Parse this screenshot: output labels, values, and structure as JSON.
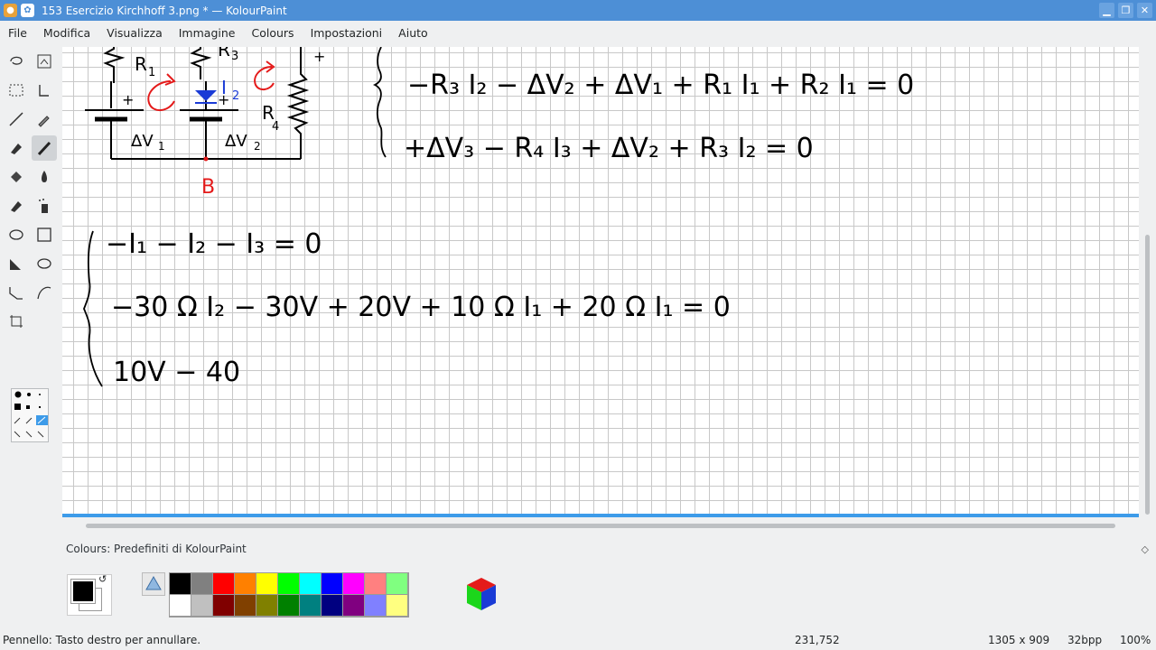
{
  "window": {
    "title": "153 Esercizio Kirchhoff 3.png * — KolourPaint",
    "controls": [
      "minimize",
      "maximize",
      "close"
    ]
  },
  "menu": [
    "File",
    "Modifica",
    "Visualizza",
    "Immagine",
    "Colours",
    "Impostazioni",
    "Aiuto"
  ],
  "tools": [
    "free-select-icon",
    "crop-icon",
    "rect-select-icon",
    "text-icon",
    "line-icon",
    "picker-icon",
    "eraser-icon",
    "brush-icon",
    "fill-icon",
    "blur-icon",
    "color-eraser-icon",
    "spraycan-icon",
    "ellipse-icon",
    "rectangle-icon",
    "polygon-icon",
    "ellipse2-icon",
    "polyline-icon",
    "curve-icon",
    "resize-icon"
  ],
  "drawing": {
    "label_R1": "R",
    "label_R1_sub": "1",
    "label_R3": "R",
    "label_R3_sub": "3",
    "label_R4": "R",
    "label_R4_sub": "4",
    "label_I2": "I",
    "label_I2_sub": "2",
    "label_dV1": "ΔV",
    "label_dV1_sub": "1",
    "label_dV2": "ΔV",
    "label_dV2_sub": "2",
    "label_B": "B",
    "plus": "+",
    "eq1": "−R₃ I₂ − ΔV₂ + ΔV₁ + R₁ I₁ + R₂ I₁ = 0",
    "eq2": "+ΔV₃ − R₄ I₃ + ΔV₂ + R₃ I₂ = 0",
    "sys1": "−I₁ − I₂ − I₃ = 0",
    "sys2": "−30 Ω I₂ − 30V + 20V + 10 Ω I₁ + 20 Ω I₁ = 0",
    "sys3": "10V − 40"
  },
  "colours": {
    "title": "Colours: Predefiniti di KolourPaint",
    "foreground": "#000000",
    "background": "#ffffff",
    "row1": [
      "#000000",
      "#808080",
      "#ff0000",
      "#ff8000",
      "#ffff00",
      "#00ff00",
      "#00ffff",
      "#0000ff",
      "#ff00ff",
      "#ff8080",
      "#80ff80"
    ],
    "row2": [
      "#ffffff",
      "#c0c0c0",
      "#800000",
      "#804000",
      "#808000",
      "#008000",
      "#008080",
      "#000080",
      "#800080",
      "#8080ff",
      "#ffff80"
    ]
  },
  "status": {
    "hint": "Pennello: Tasto destro per annullare.",
    "coords": "231,752",
    "size": "1305 x 909",
    "depth": "32bpp",
    "zoom": "100%"
  }
}
